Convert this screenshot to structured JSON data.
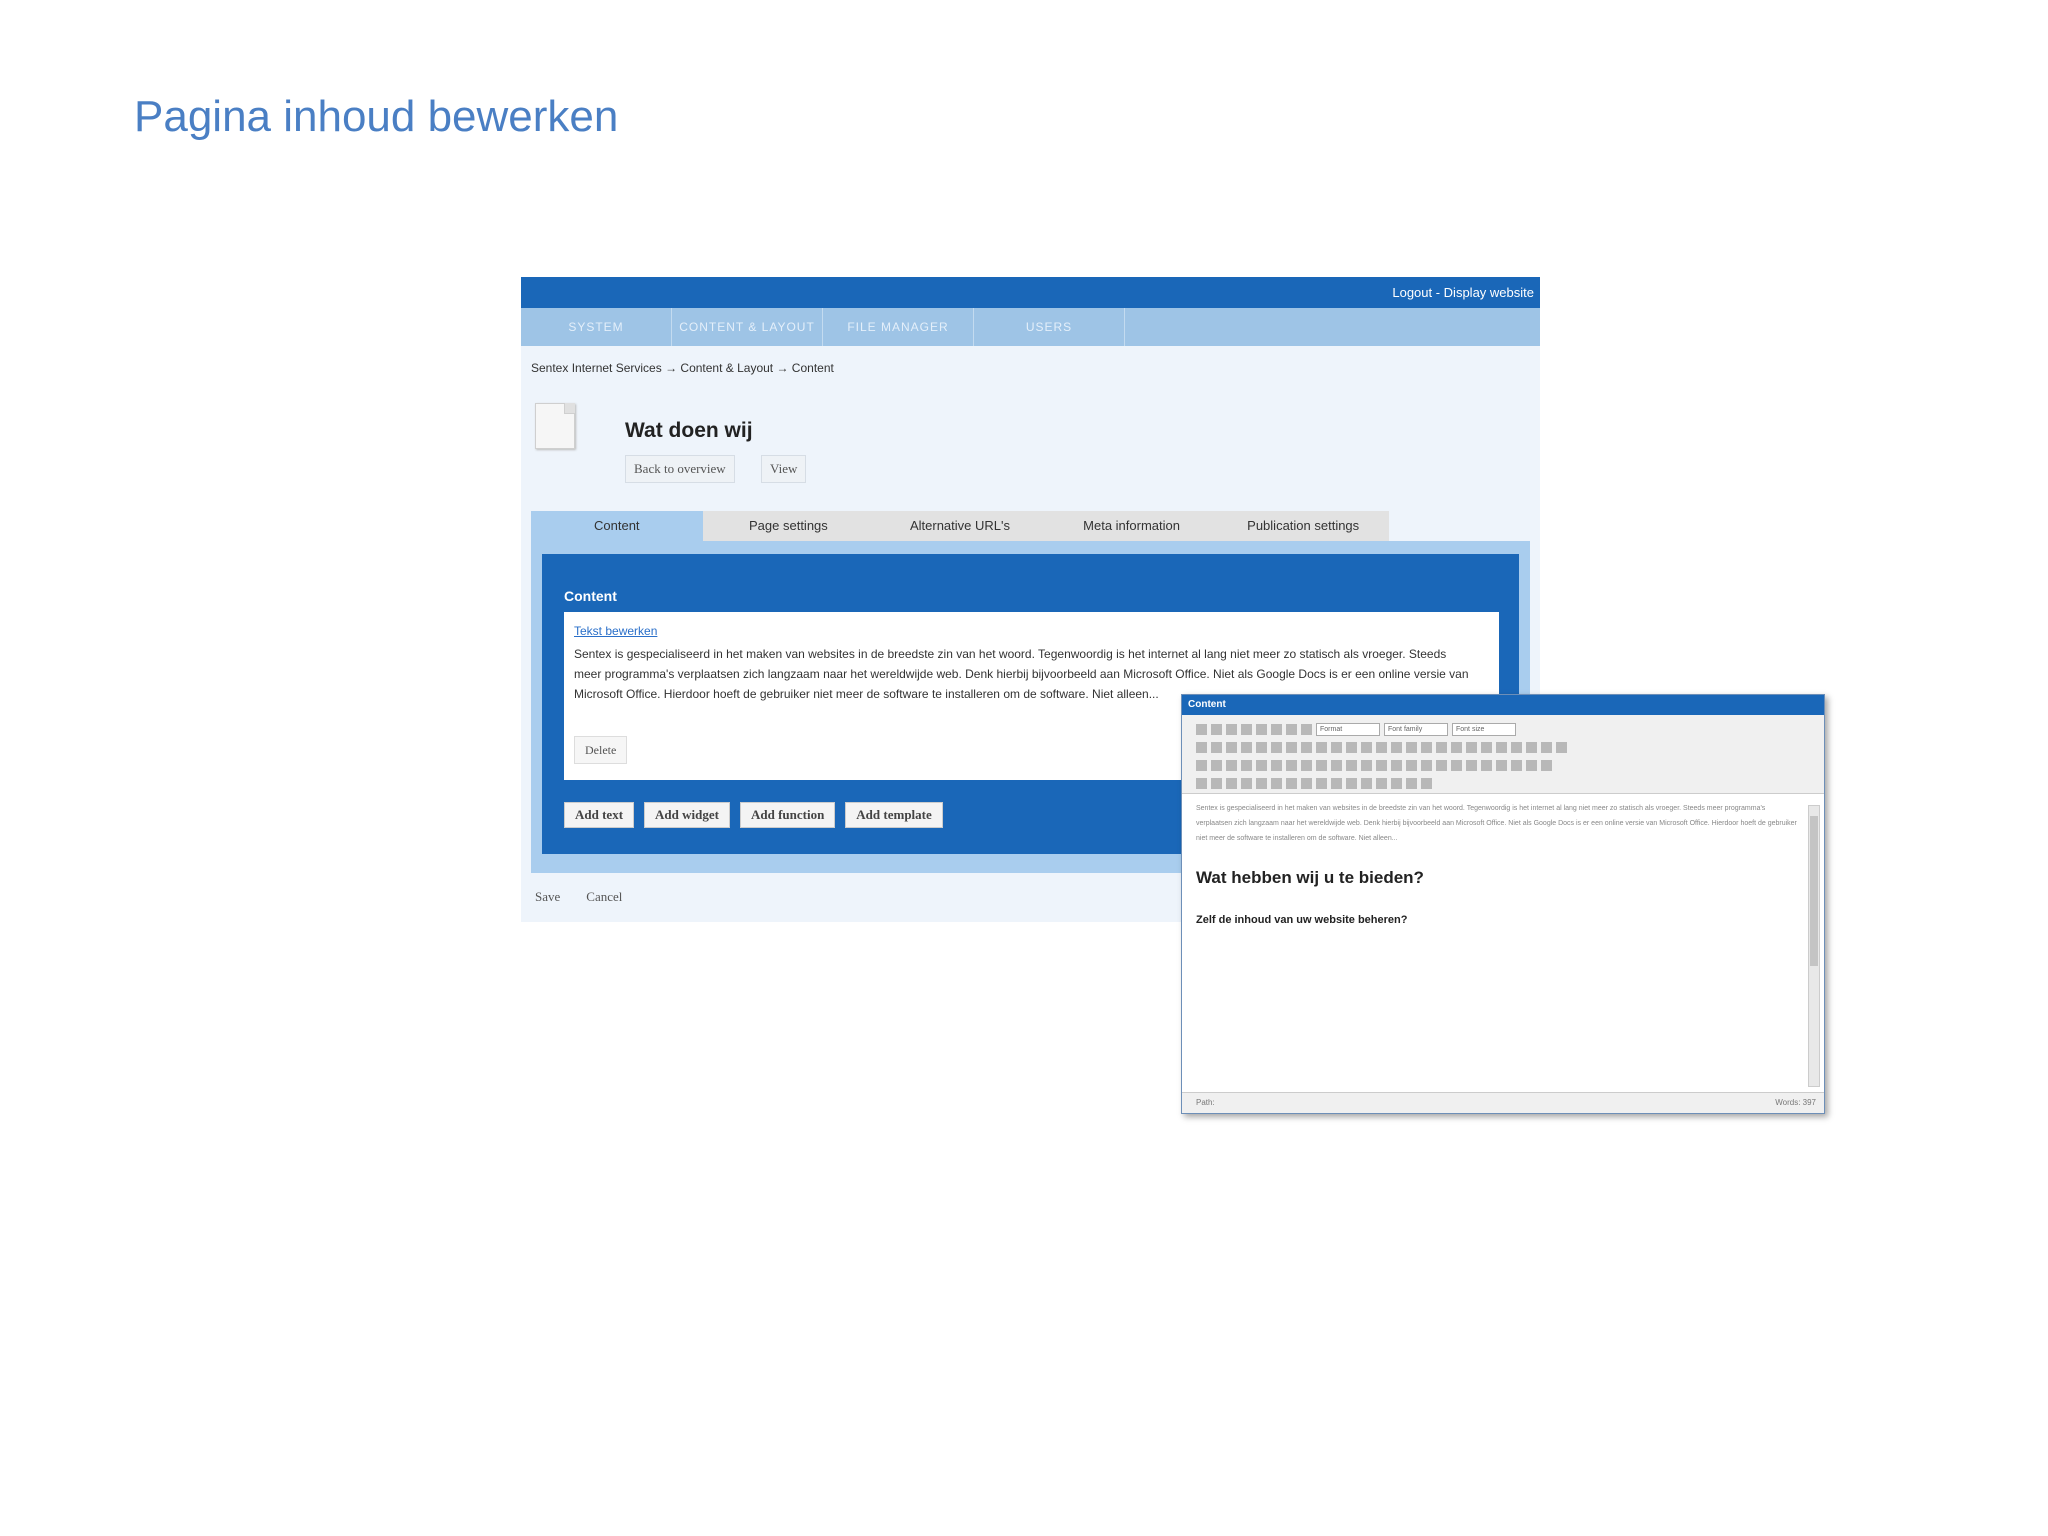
{
  "slide": {
    "title": "Pagina inhoud bewerken"
  },
  "cms": {
    "top_links": "Logout - Display website",
    "nav": [
      "SYSTEM",
      "CONTENT & LAYOUT",
      "FILE MANAGER",
      "USERS"
    ],
    "breadcrumb": "Sentex Internet Services → Content & Layout → Content",
    "page_title": "Wat doen wij",
    "back_label": "Back to overview",
    "view_label": "View",
    "tabs": [
      "Content",
      "Page settings",
      "Alternative URL's",
      "Meta information",
      "Publication settings"
    ],
    "panel_title": "Content",
    "edit_link": "Tekst bewerken",
    "content_text": "Sentex is gespecialiseerd in het maken van websites in de breedste zin van het woord. Tegenwoordig is het internet al lang niet meer zo statisch als vroeger. Steeds meer programma's verplaatsen zich langzaam naar het wereldwijde web. Denk hierbij bijvoorbeeld aan Microsoft Office. Niet als Google Docs is er een online versie van Microsoft Office. Hierdoor hoeft de gebruiker niet meer de software te installeren om de software. Niet alleen...",
    "delete_label": "Delete",
    "add_buttons": [
      "Add text",
      "Add widget",
      "Add function",
      "Add template"
    ],
    "save_label": "Save",
    "cancel_label": "Cancel"
  },
  "editor": {
    "title": "Content",
    "format_select": "Format",
    "font_family_select": "Font family",
    "font_size_select": "Font size",
    "heading1": "Wat hebben wij u te bieden?",
    "heading2": "Zelf de inhoud van uw website beheren?",
    "status_path": "Path:",
    "status_words": "Words: 397"
  }
}
